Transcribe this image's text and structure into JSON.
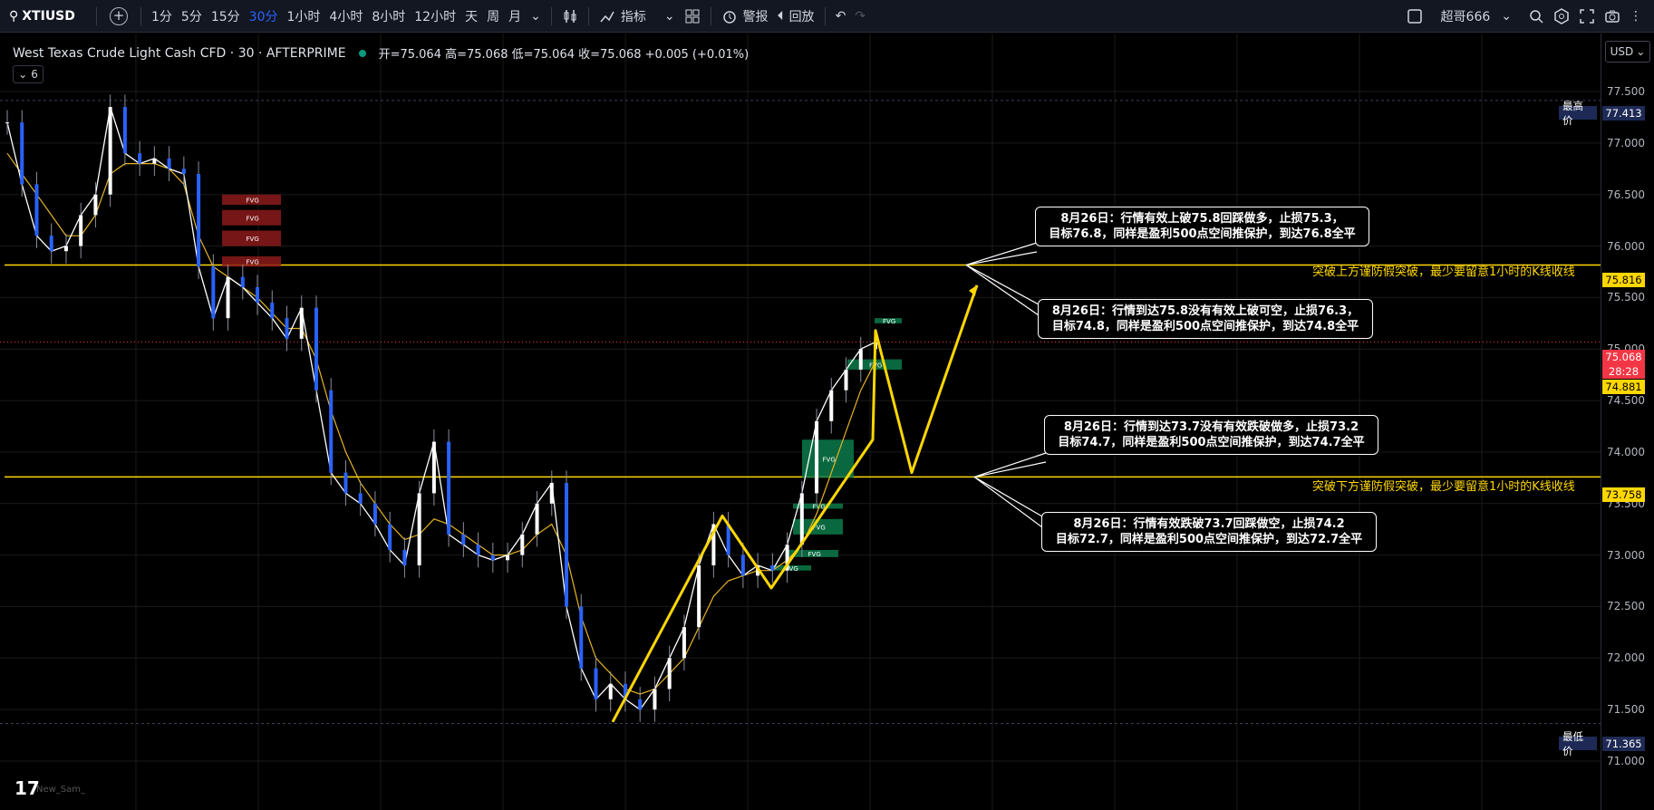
{
  "toolbar": {
    "symbol": "XTIUSD",
    "timeframes": [
      "1分",
      "5分",
      "15分",
      "30分",
      "1小时",
      "4小时",
      "8小时",
      "12小时",
      "天",
      "周",
      "月"
    ],
    "active_timeframe": "30分",
    "indicators_label": "指标",
    "alert_label": "警报",
    "replay_label": "回放",
    "account_label": "超哥666"
  },
  "legend": {
    "title": "West Texas Crude Light Cash CFD · 30 · AFTERPRIME",
    "ohlc": "开=75.064 高=75.068 低=75.064 收=75.068 +0.005 (+0.01%)",
    "collapse_count": "6"
  },
  "currency": "USD",
  "price_labels": {
    "high_label": "最高价",
    "high_value": "77.413",
    "low_label": "最低价",
    "low_value": "71.365",
    "current": "75.068",
    "countdown": "28:28",
    "upper_line": "75.816",
    "lower_line": "73.758",
    "ma_value": "74.881"
  },
  "colors": {
    "accent": "#2962ff",
    "yellow": "#ffd700",
    "current_price": "#f23645",
    "up_candle": "#ffffff",
    "ma_line": "#e6b422",
    "fvg_green": "#089981",
    "fvg_red": "#b22222"
  },
  "horizontal_lines": [
    {
      "price": 75.816,
      "label": "突破上方谨防假突破，最少要留意1小时的K线收线"
    },
    {
      "price": 73.758,
      "label": "突破下方谨防假突破，最少要留意1小时的K线收线"
    }
  ],
  "callouts": [
    {
      "line1": "8月26日：行情有效上破75.8回踩做多，止损75.3，",
      "line2": "目标76.8，同样是盈利500点空间推保护，到达76.8全平"
    },
    {
      "line1": "8月26日：行情到达75.8没有有效上破可空，止损76.3，",
      "line2": "目标74.8，同样是盈利500点空间推保护，到达74.8全平"
    },
    {
      "line1": "8月26日：行情到达73.7没有有效跌破做多，止损73.2",
      "line2": "目标74.7，同样是盈利500点空间推保护，到达74.7全平"
    },
    {
      "line1": "8月26日：行情有效跌破73.7回踩做空，止损74.2",
      "line2": "目标72.7，同样是盈利500点空间推保护，到达72.7全平"
    }
  ],
  "fvg_label": "FVG",
  "logo_text": "17",
  "logo_sub": "New_Sam_",
  "chart_data": {
    "type": "line",
    "title": "West Texas Crude Light Cash CFD · 30 · AFTERPRIME",
    "ylim": [
      70.8,
      77.8
    ],
    "y_ticks": [
      71.0,
      71.5,
      72.0,
      72.5,
      73.0,
      73.5,
      74.0,
      74.5,
      75.0,
      75.5,
      76.0,
      76.5,
      77.0,
      77.5
    ],
    "y_tick_labels": [
      "71.000",
      "71.500",
      "72.000",
      "72.500",
      "73.000",
      "73.500",
      "74.000",
      "74.500",
      "75.000",
      "75.500",
      "76.000",
      "76.500",
      "77.000",
      "77.500"
    ],
    "series": [
      {
        "values": [
          77.2,
          76.6,
          76.1,
          75.95,
          76.0,
          76.3,
          76.5,
          77.35,
          76.9,
          76.8,
          76.85,
          76.75,
          76.7,
          75.8,
          75.3,
          75.7,
          75.6,
          75.45,
          75.3,
          75.1,
          75.4,
          74.6,
          73.8,
          73.6,
          73.5,
          73.3,
          73.05,
          72.9,
          73.6,
          74.1,
          73.2,
          73.1,
          73.0,
          72.95,
          73.0,
          73.2,
          73.5,
          73.7,
          72.5,
          71.9,
          71.6,
          71.75,
          71.6,
          71.5,
          71.7,
          72.0,
          72.3,
          72.9,
          73.3,
          73.0,
          72.8,
          72.9,
          72.85,
          73.1,
          73.6,
          74.3,
          74.6,
          74.8,
          75.0,
          75.068
        ]
      },
      {
        "values": [
          76.9,
          76.7,
          76.5,
          76.3,
          76.1,
          76.1,
          76.3,
          76.7,
          76.8,
          76.8,
          76.8,
          76.75,
          76.6,
          76.1,
          75.8,
          75.7,
          75.6,
          75.5,
          75.35,
          75.2,
          75.2,
          74.9,
          74.4,
          74.0,
          73.7,
          73.5,
          73.3,
          73.15,
          73.2,
          73.35,
          73.3,
          73.2,
          73.1,
          73.0,
          73.0,
          73.05,
          73.2,
          73.3,
          73.0,
          72.4,
          72.0,
          71.85,
          71.7,
          71.65,
          71.7,
          71.85,
          72.0,
          72.3,
          72.6,
          72.75,
          72.8,
          72.85,
          72.85,
          72.95,
          73.1,
          73.4,
          73.8,
          74.2,
          74.6,
          74.881
        ]
      }
    ],
    "drawn_path_prices": [
      71.38,
      73.38,
      72.68,
      74.12,
      75.18,
      73.8,
      75.62
    ],
    "fvg_zones": [
      {
        "color": "red",
        "top": 76.5,
        "bottom": 76.4
      },
      {
        "color": "red",
        "top": 76.35,
        "bottom": 76.2
      },
      {
        "color": "red",
        "top": 76.15,
        "bottom": 76.0
      },
      {
        "color": "red",
        "top": 75.9,
        "bottom": 75.8
      },
      {
        "color": "green",
        "top": 75.3,
        "bottom": 75.25
      },
      {
        "color": "green",
        "top": 74.9,
        "bottom": 74.8
      },
      {
        "color": "green",
        "top": 74.12,
        "bottom": 73.75
      },
      {
        "color": "green",
        "top": 73.5,
        "bottom": 73.45
      },
      {
        "color": "green",
        "top": 73.35,
        "bottom": 73.2
      },
      {
        "color": "green",
        "top": 73.05,
        "bottom": 72.98
      },
      {
        "color": "green",
        "top": 72.9,
        "bottom": 72.85
      }
    ]
  }
}
